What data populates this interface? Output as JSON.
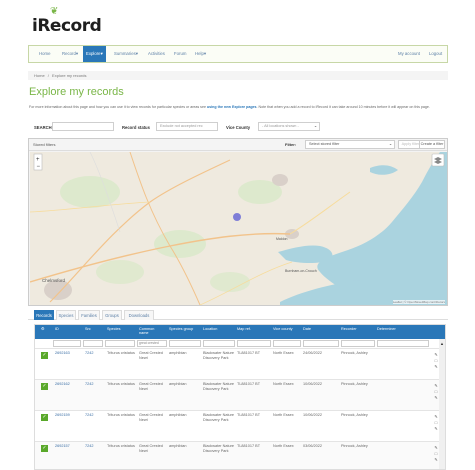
{
  "app": {
    "logo_text": "iRecord"
  },
  "nav": {
    "home": "Home",
    "record": "Record",
    "explore": "Explore",
    "summaries": "Summaries",
    "activities": "Activities",
    "forum": "Forum",
    "help": "Help",
    "my_account": "My account",
    "logout": "Logout"
  },
  "breadcrumb": {
    "home": "Home",
    "sep": "/",
    "current": "Explore my records"
  },
  "page": {
    "title": "Explore my records"
  },
  "intro": {
    "part1": "For more information about this page and how you can use it to view records for particular species or areas see",
    "link": "using the new Explore pages",
    "part2": ". Note that when you add a record to iRecord it can take around 10 minutes before it will appear on this page."
  },
  "filters": {
    "search_label": "SEARCH",
    "search_value": "",
    "record_status_label": "Record status",
    "record_status_value": "Exclude not accepted rec",
    "vice_county_label": "Vice County",
    "vice_county_value": "- All locations shown -"
  },
  "map_panel": {
    "stored_filters": "Stored filters",
    "filter_label": "Filter:",
    "filter_value": "Select stored filter",
    "apply_button": "Apply filter",
    "reset_button": "Reset",
    "create_button": "Create a filter",
    "attribution": "Leaflet | © OpenStreetMap contributors",
    "place_labels": [
      "Chelmsford",
      "Maldon",
      "Burnham-on-Crouch"
    ]
  },
  "tabs": [
    "Records",
    "Species",
    "Families",
    "Groups",
    "Downloads"
  ],
  "grid": {
    "headers": [
      "ID",
      "Src",
      "Species",
      "Common name",
      "Species group",
      "Location",
      "Map ref.",
      "Vice county",
      "Date",
      "Recorder",
      "Determiner"
    ],
    "filter_values": [
      "",
      "",
      "",
      "great crested",
      "",
      "",
      "",
      "",
      "",
      "",
      ""
    ],
    "rows": [
      {
        "id": "2692163",
        "src": "7242",
        "species": "Triturus cristatus",
        "common": "Great Crested Newt",
        "group": "amphibian",
        "location": "Blackwater Nature Discovery Park",
        "mapref": "TL881017 BT",
        "vc": "North Essex",
        "date": "24/06/2022",
        "recorder": "Pinnock, Ashley"
      },
      {
        "id": "2692162",
        "src": "7242",
        "species": "Triturus cristatus",
        "common": "Great Crested Newt",
        "group": "amphibian",
        "location": "Blackwater Nature Discovery Park",
        "mapref": "TL881017 BT",
        "vc": "North Essex",
        "date": "10/06/2022",
        "recorder": "Pinnock, Ashley"
      },
      {
        "id": "2692159",
        "src": "7242",
        "species": "Triturus cristatus",
        "common": "Great Crested Newt",
        "group": "amphibian",
        "location": "Blackwater Nature Discovery Park",
        "mapref": "TL881017 BT",
        "vc": "North Essex",
        "date": "10/06/2022",
        "recorder": "Pinnock, Ashley"
      },
      {
        "id": "2692157",
        "src": "7242",
        "species": "Triturus cristatus",
        "common": "Great Crested Newt",
        "group": "amphibian",
        "location": "Blackwater Nature Discovery Park",
        "mapref": "TL881017 BT",
        "vc": "North Essex",
        "date": "03/06/2022",
        "recorder": "Pinnock, Ashley"
      }
    ]
  },
  "icons": {
    "check": "checkmark-icon",
    "row_actions": [
      "edit-icon",
      "view-icon",
      "comment-icon"
    ],
    "layers": "layers-icon",
    "zoom": [
      "zoom-in-icon",
      "zoom-out-icon"
    ]
  },
  "colors": {
    "brand_green": "#7ab648",
    "nav_blue": "#2a77b8",
    "verified_green": "#59a82a"
  }
}
